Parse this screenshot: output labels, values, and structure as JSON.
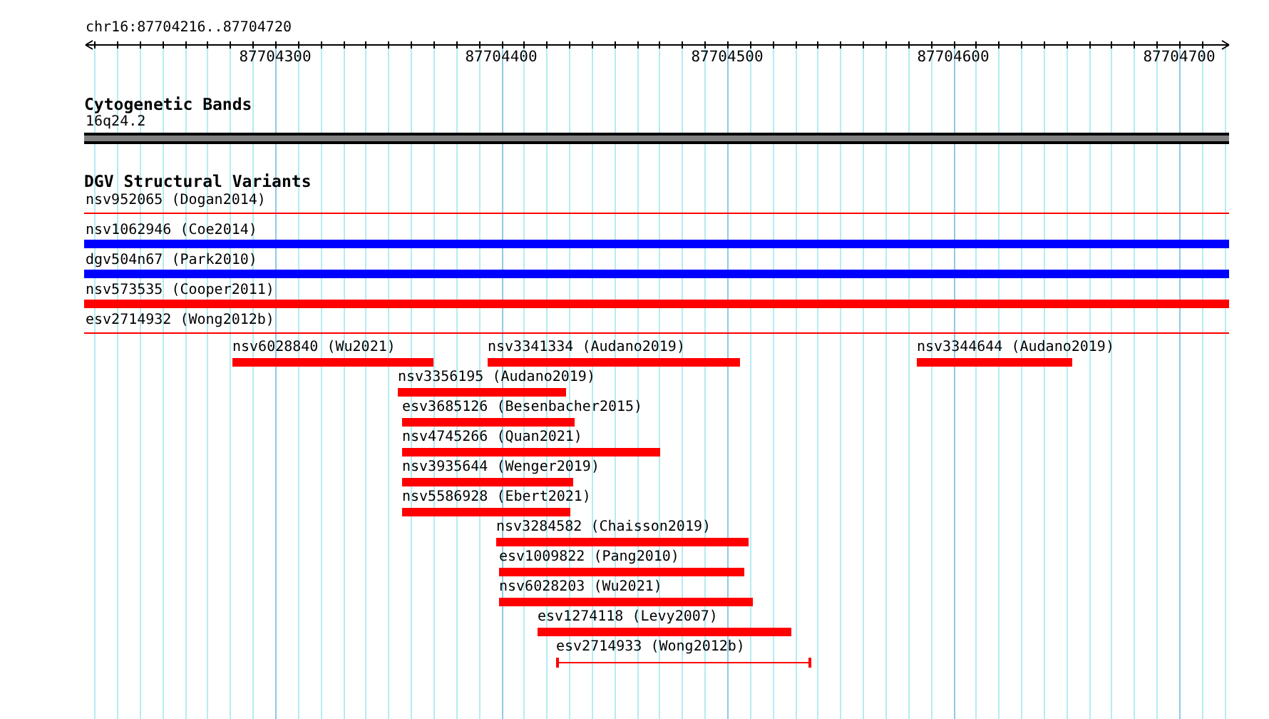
{
  "ruler": {
    "location": "chr16:87704216..87704720",
    "tick_labels": [
      "87704300",
      "87704400",
      "87704500",
      "87704600",
      "87704700"
    ]
  },
  "tracks": [
    {
      "title": "Cytogenetic Bands",
      "kind": "cytoband",
      "features": [
        {
          "label": "16q24.2",
          "color": "#808080"
        }
      ]
    },
    {
      "title": "DGV Structural Variants",
      "kind": "variants",
      "features": [
        {
          "label": "nsv952065 (Dogan2014)",
          "color": "#ff0000",
          "kind": "thin"
        },
        {
          "label": "nsv1062946 (Coe2014)",
          "color": "#0000ff",
          "kind": "thick"
        },
        {
          "label": "dgv504n67 (Park2010)",
          "color": "#0000ff",
          "kind": "thick"
        },
        {
          "label": "nsv573535 (Cooper2011)",
          "color": "#ff0000",
          "kind": "thick"
        },
        {
          "label": "esv2714932 (Wong2012b)",
          "color": "#ff0000",
          "kind": "thin"
        },
        {
          "label": "nsv6028840 (Wu2021)",
          "color": "#ff0000",
          "kind": "thick"
        },
        {
          "label": "nsv3341334 (Audano2019)",
          "color": "#ff0000",
          "kind": "thick"
        },
        {
          "label": "nsv3344644 (Audano2019)",
          "color": "#ff0000",
          "kind": "thick"
        },
        {
          "label": "nsv3356195 (Audano2019)",
          "color": "#ff0000",
          "kind": "thick"
        },
        {
          "label": "esv3685126 (Besenbacher2015)",
          "color": "#ff0000",
          "kind": "thick"
        },
        {
          "label": "nsv4745266 (Quan2021)",
          "color": "#ff0000",
          "kind": "thick"
        },
        {
          "label": "nsv3935644 (Wenger2019)",
          "color": "#ff0000",
          "kind": "thick"
        },
        {
          "label": "nsv5586928 (Ebert2021)",
          "color": "#ff0000",
          "kind": "thick"
        },
        {
          "label": "nsv3284582 (Chaisson2019)",
          "color": "#ff0000",
          "kind": "thick"
        },
        {
          "label": "esv1009822 (Pang2010)",
          "color": "#ff0000",
          "kind": "thick"
        },
        {
          "label": "nsv6028203 (Wu2021)",
          "color": "#ff0000",
          "kind": "thick"
        },
        {
          "label": "esv1274118 (Levy2007)",
          "color": "#ff0000",
          "kind": "thick"
        },
        {
          "label": "esv2714933 (Wong2012b)",
          "color": "#ff0000",
          "kind": "capped"
        }
      ]
    }
  ]
}
